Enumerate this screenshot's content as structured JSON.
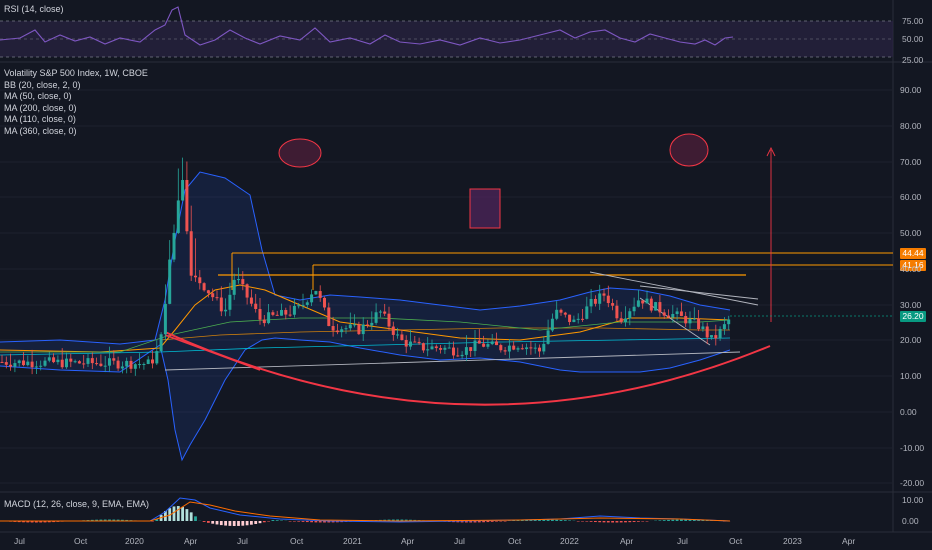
{
  "panels": {
    "rsi": {
      "title": "RSI (14, close)",
      "ticks": [
        "75.00",
        "50.00",
        "25.00"
      ]
    },
    "main": {
      "title": "Volatility S&P 500 Index, 1W, CBOE",
      "indicators": [
        "BB (20, close, 2, 0)",
        "MA (50, close, 0)",
        "MA (200, close, 0)",
        "MA (110, close, 0)",
        "MA (360, close, 0)"
      ],
      "ticks": [
        "90.00",
        "80.00",
        "70.00",
        "60.00",
        "50.00",
        "40.00",
        "30.00",
        "20.00",
        "10.00",
        "0.00",
        "-10.00",
        "-20.00"
      ]
    },
    "macd": {
      "title": "MACD (12, 26, close, 9, EMA, EMA)",
      "ticks": [
        "10.00",
        "0.00"
      ]
    }
  },
  "price_tags": [
    {
      "text": "44.44",
      "color": "#f57c00"
    },
    {
      "text": "41.16",
      "color": "#f57c00"
    },
    {
      "text": "26.20",
      "color": "#089981"
    }
  ],
  "time_axis": [
    "Jul",
    "Oct",
    "2020",
    "Apr",
    "Jul",
    "Oct",
    "2021",
    "Apr",
    "Jul",
    "Oct",
    "2022",
    "Apr",
    "Jul",
    "Oct",
    "2023",
    "Apr"
  ],
  "colors": {
    "up": "#26a69a",
    "down": "#ef5350",
    "bb": "#2962ff",
    "level": "#ff9800",
    "arc": "#f23645",
    "bg": "#131722"
  },
  "chart_data": {
    "type": "candlestick",
    "title": "Volatility S&P 500 Index, 1W, CBOE",
    "ylim": [
      -20,
      90
    ],
    "grid": true,
    "horizontal_levels": [
      44.44,
      41.16,
      38.0
    ],
    "last_price": 26.2,
    "x": [
      "2019-07",
      "2019-10",
      "2020-01",
      "2020-04",
      "2020-07",
      "2020-10",
      "2021-01",
      "2021-04",
      "2021-07",
      "2021-10",
      "2022-01",
      "2022-04",
      "2022-07",
      "2022-09"
    ],
    "close_approx": [
      14,
      13,
      14,
      45,
      27,
      29,
      22,
      19,
      17,
      18,
      25,
      29,
      24,
      26.2
    ]
  }
}
